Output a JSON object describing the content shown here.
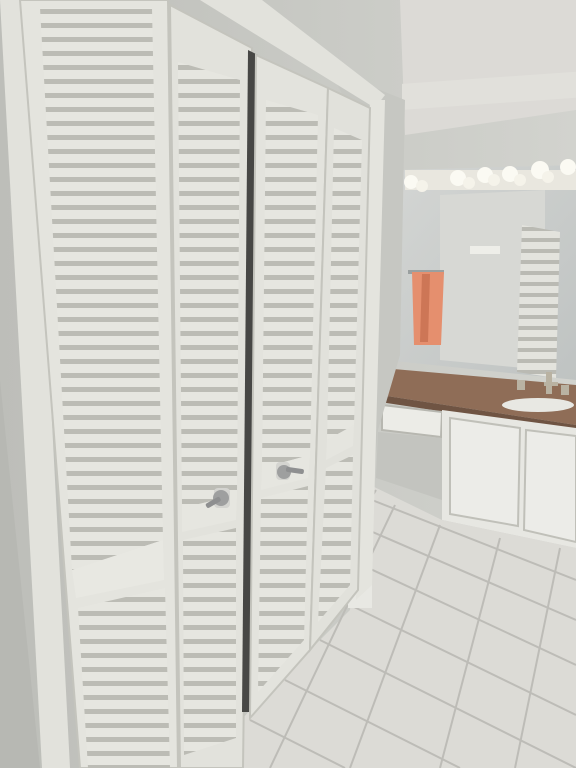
{
  "scene": {
    "kind": "photo",
    "colors": {
      "wall": "#c9cac5",
      "ceiling": "#dcdad6",
      "door": "#e4e4de",
      "door_shadow": "#b8b9b3",
      "floor_tile": "#dcdbd6",
      "grout": "#bdbcb7",
      "counter": "#8f6d57",
      "cabinet": "#e7e7e2",
      "towel": "#e58f6e",
      "mirror": "#cdd0cf",
      "bulb": "#fbfaf3",
      "knob": "#9e9f9f"
    },
    "icons": [
      "door-knob-icon",
      "vanity-light-bulb-icon",
      "faucet-icon"
    ]
  }
}
